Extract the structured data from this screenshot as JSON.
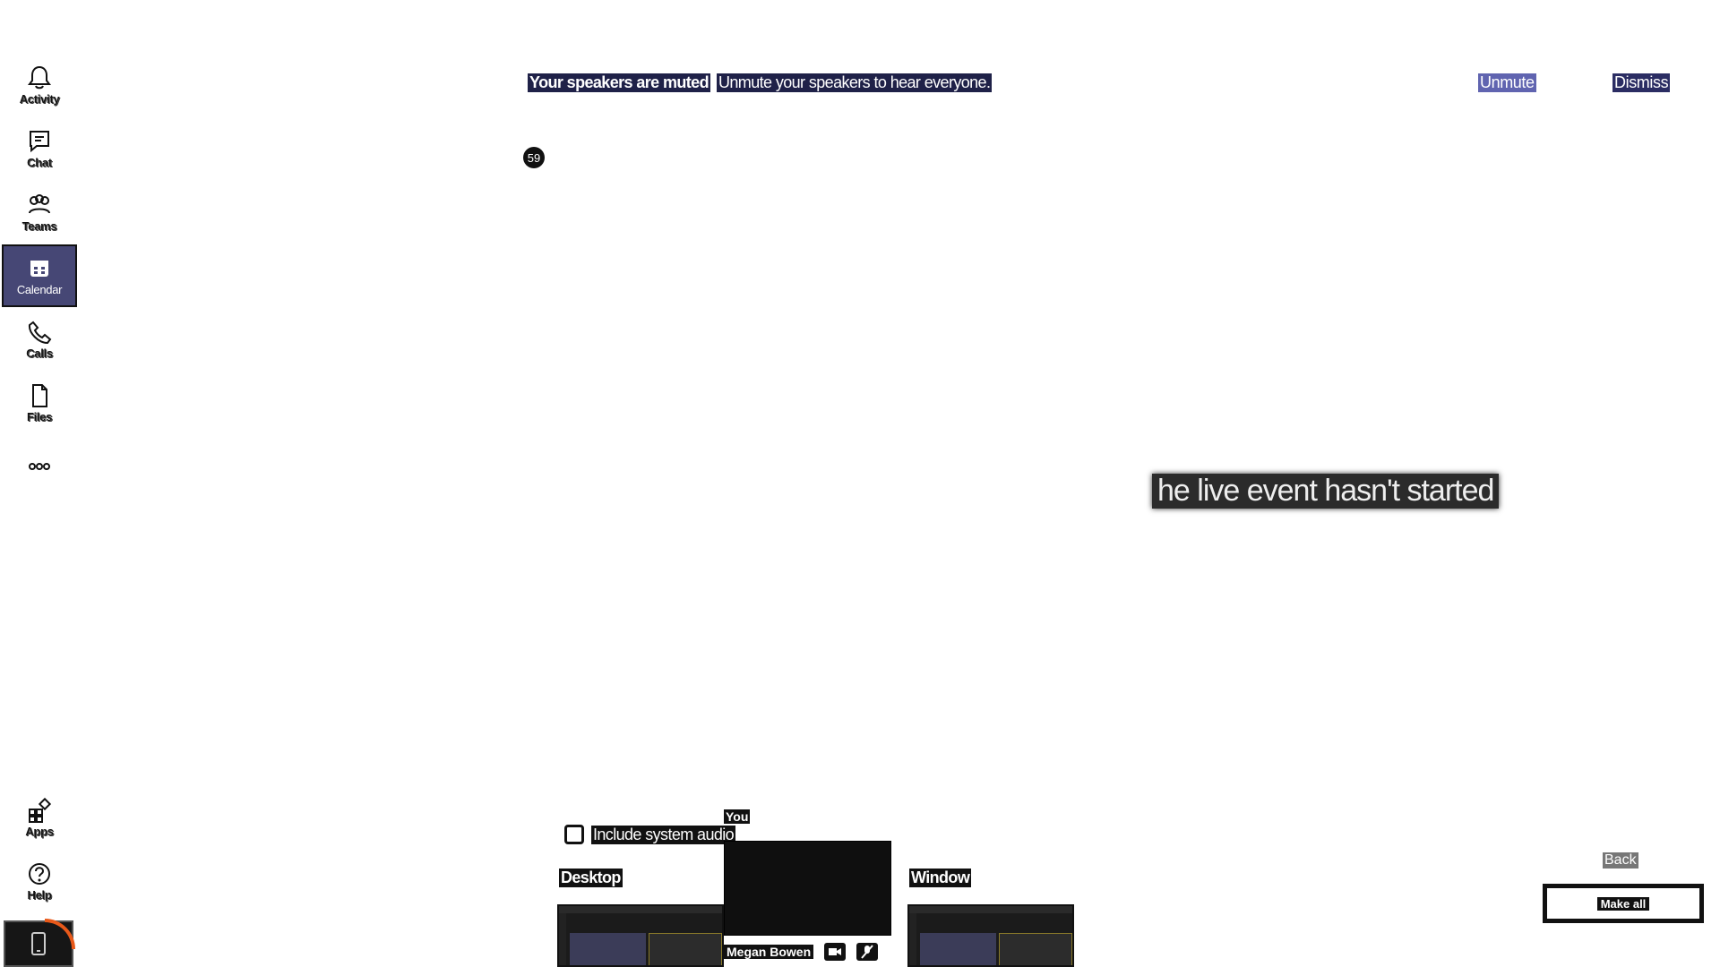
{
  "rail": {
    "items": [
      {
        "label": "Activity",
        "icon": "bell-icon"
      },
      {
        "label": "Chat",
        "icon": "chat-icon"
      },
      {
        "label": "Teams",
        "icon": "teams-icon"
      },
      {
        "label": "Calendar",
        "icon": "calendar-icon",
        "active": true
      },
      {
        "label": "Calls",
        "icon": "phone-icon"
      },
      {
        "label": "Files",
        "icon": "file-icon"
      },
      {
        "label": "",
        "icon": "more-icon"
      },
      {
        "label": "Apps",
        "icon": "apps-icon"
      },
      {
        "label": "Help",
        "icon": "help-icon"
      }
    ],
    "mobile_icon": "mobile-icon",
    "accent_color": "#464775"
  },
  "banner": {
    "title": "Your speakers are muted",
    "message": "Unmute your speakers to hear everyone.",
    "unmute_label": "Unmute",
    "dismiss_label": "Dismiss"
  },
  "counter": "59",
  "stage": {
    "status_text": "he live event hasn't started"
  },
  "share_tray": {
    "you_label": "You",
    "include_audio_label": "Include system audio",
    "desktop_label": "Desktop",
    "window_label": "Window",
    "presenter_name": "Megan Bowen"
  },
  "controls": {
    "back_label": "Back",
    "make_all_label": "Make all"
  }
}
